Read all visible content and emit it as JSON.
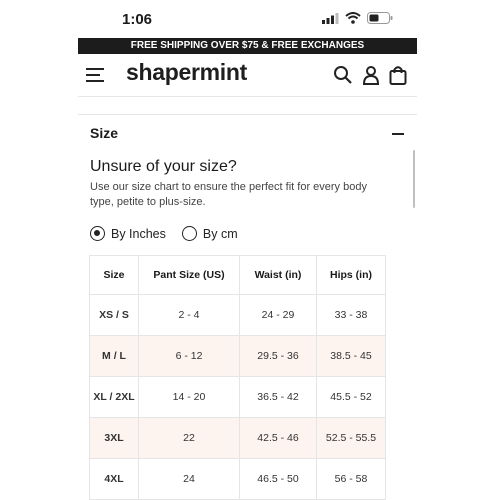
{
  "status_bar": {
    "time": "1:06"
  },
  "promo_banner": "FREE SHIPPING OVER $75 & FREE EXCHANGES",
  "header": {
    "logo": "shapermint",
    "icons": [
      "menu-icon",
      "search-icon",
      "account-icon",
      "bag-icon"
    ]
  },
  "section": {
    "title": "Size",
    "subtitle": "Unsure of your size?",
    "description": "Use our size chart to ensure the perfect fit for every body type, petite to plus-size."
  },
  "units": {
    "inches_label": "By Inches",
    "cm_label": "By cm",
    "selected": "By Inches"
  },
  "size_table": {
    "headers": [
      "Size",
      "Pant Size (US)",
      "Waist (in)",
      "Hips (in)"
    ],
    "rows": [
      [
        "XS / S",
        "2 - 4",
        "24 - 29",
        "33 - 38"
      ],
      [
        "M / L",
        "6 - 12",
        "29.5 - 36",
        "38.5 - 45"
      ],
      [
        "XL / 2XL",
        "14 - 20",
        "36.5 - 42",
        "45.5 - 52"
      ],
      [
        "3XL",
        "22",
        "42.5 - 46",
        "52.5 - 55.5"
      ],
      [
        "4XL",
        "24",
        "46.5 - 50",
        "56 - 58"
      ]
    ]
  },
  "colors": {
    "banner_bg": "#1c1c1c",
    "row_highlight": "#fdf3ef"
  }
}
